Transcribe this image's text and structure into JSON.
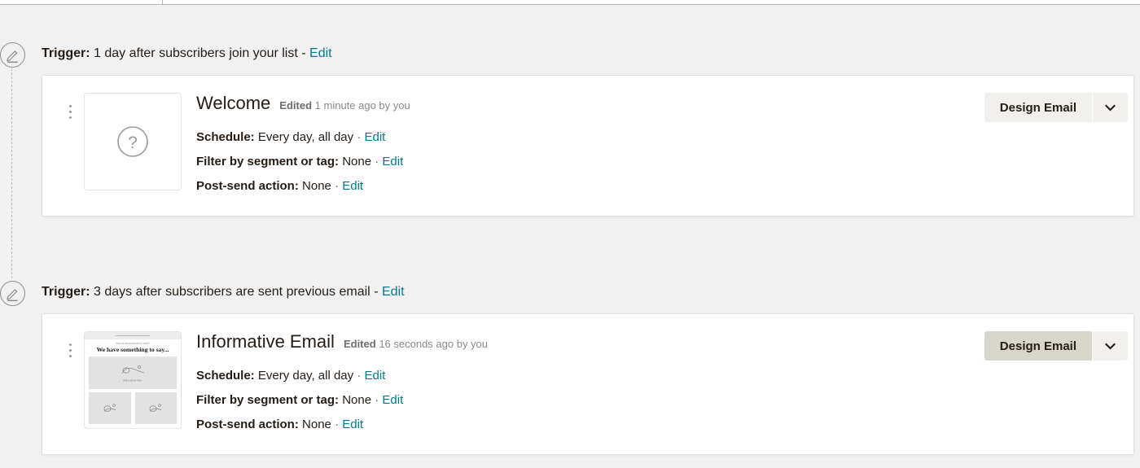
{
  "theme": {
    "page_bg": "#f1f1f1",
    "card_bg": "#ffffff",
    "link_color": "#007c89",
    "text_color": "#241c15",
    "muted_color": "#8a8a8a",
    "button_bg": "#f1f0ec",
    "button_hover_bg": "#d8d5cb"
  },
  "icons": {
    "pencil": "pencil-edit-icon",
    "kebab": "kebab-menu-icon",
    "chevron": "chevron-down-icon",
    "question": "question-mark-icon"
  },
  "steps": [
    {
      "trigger": {
        "label": "Trigger:",
        "value": "1 day after subscribers join your list",
        "dash": "-",
        "edit": "Edit"
      },
      "email": {
        "title": "Welcome",
        "edited_label": "Edited",
        "edited_value": "1 minute ago by you",
        "thumbnail_type": "placeholder",
        "details": [
          {
            "label": "Schedule:",
            "value": "Every day, all day",
            "sep": "·",
            "edit": "Edit"
          },
          {
            "label": "Filter by segment or tag:",
            "value": "None",
            "sep": "·",
            "edit": "Edit"
          },
          {
            "label": "Post-send action:",
            "value": "None",
            "sep": "·",
            "edit": "Edit"
          }
        ],
        "action": {
          "label": "Design Email",
          "caret": "⌄",
          "hovered": false
        }
      }
    },
    {
      "trigger": {
        "label": "Trigger:",
        "value": "3 days after subscribers are sent previous email",
        "dash": "-",
        "edit": "Edit"
      },
      "email": {
        "title": "Informative Email",
        "edited_label": "Edited",
        "edited_value": "16 seconds ago by you",
        "thumbnail_type": "preview",
        "preview": {
          "kicker": "Have an announcement to make?",
          "headline": "We have something to say...",
          "hero_caption": "Add a photo here."
        },
        "details": [
          {
            "label": "Schedule:",
            "value": "Every day, all day",
            "sep": "·",
            "edit": "Edit"
          },
          {
            "label": "Filter by segment or tag:",
            "value": "None",
            "sep": "·",
            "edit": "Edit"
          },
          {
            "label": "Post-send action:",
            "value": "None",
            "sep": "·",
            "edit": "Edit"
          }
        ],
        "action": {
          "label": "Design Email",
          "caret": "⌄",
          "hovered": true
        }
      }
    }
  ]
}
